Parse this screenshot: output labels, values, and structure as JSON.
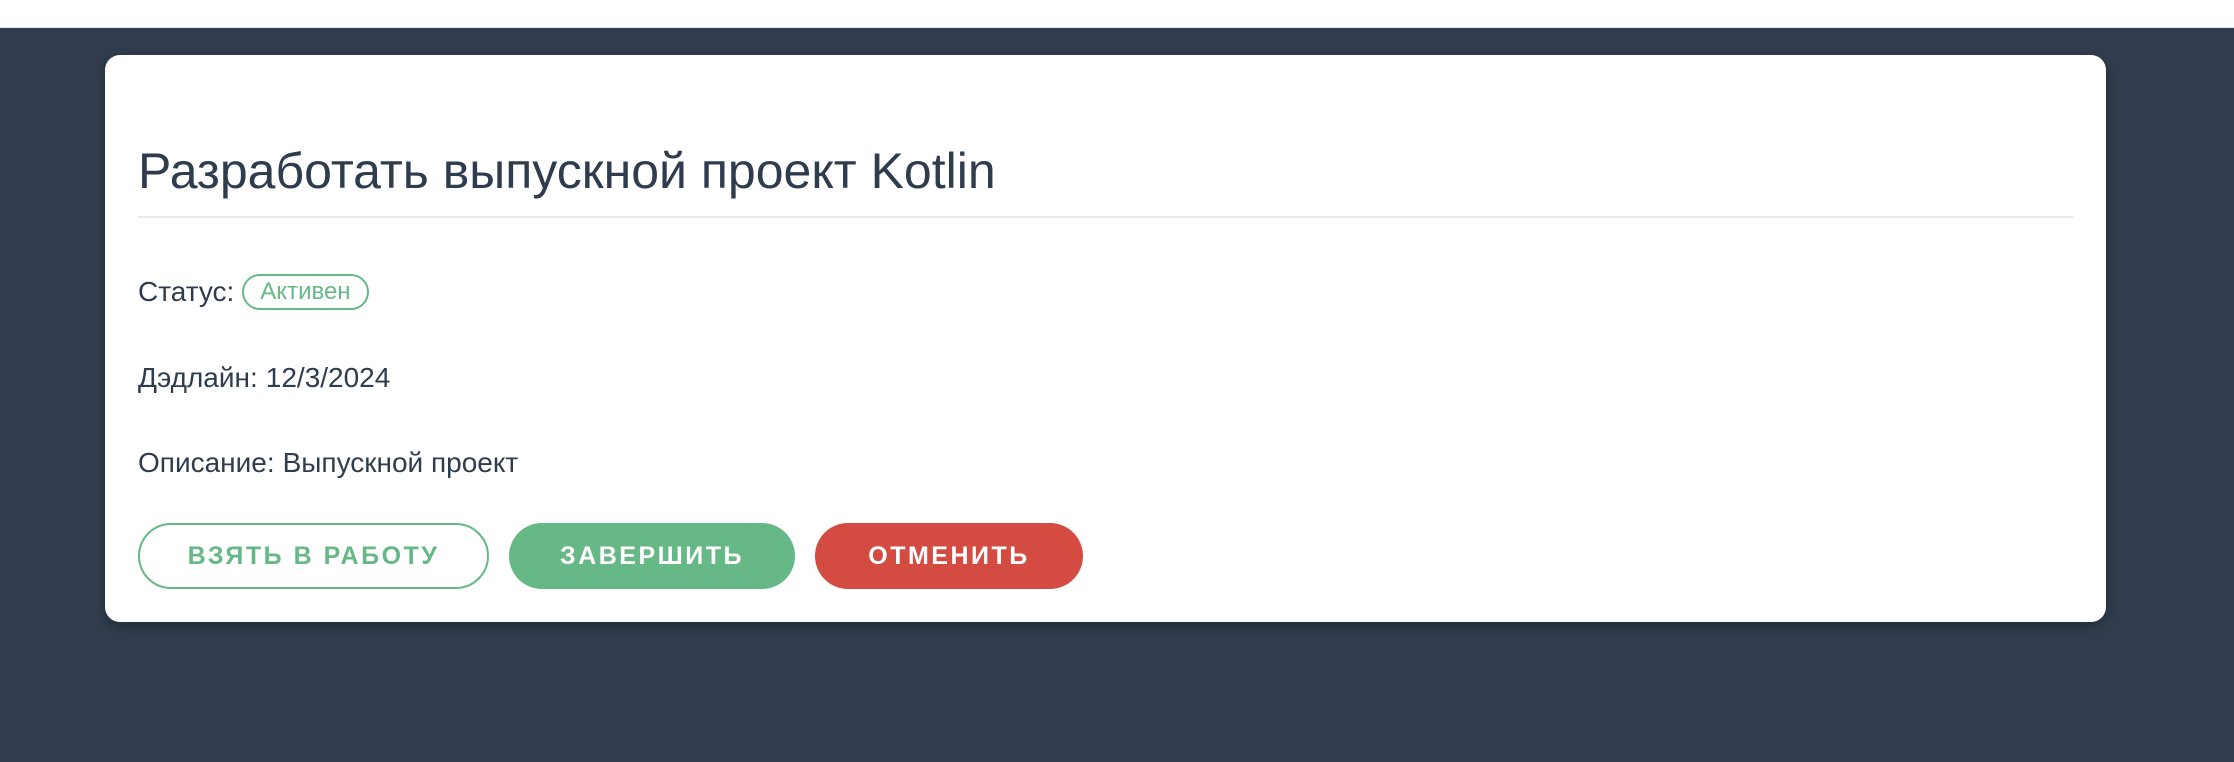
{
  "task": {
    "title": "Разработать выпускной проект Kotlin",
    "status_label": "Статус:",
    "status_value": "Активен",
    "deadline_label": "Дэдлайн:",
    "deadline_value": "12/3/2024",
    "description_label": "Описание:",
    "description_value": "Выпускной проект"
  },
  "actions": {
    "take": "ВЗЯТЬ В РАБОТУ",
    "complete": "ЗАВЕРШИТЬ",
    "cancel": "ОТМЕНИТЬ"
  },
  "colors": {
    "background": "#323e4f",
    "accent_green": "#66b887",
    "danger_red": "#d44b41",
    "text": "#2f3c4e"
  }
}
